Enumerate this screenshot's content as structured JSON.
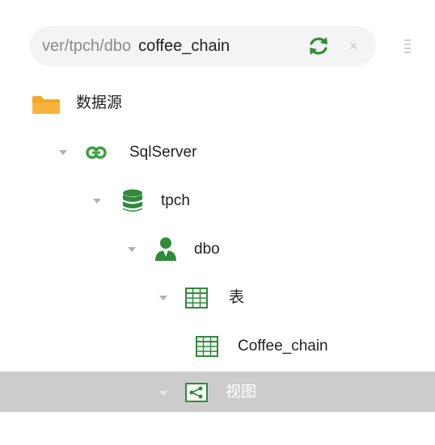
{
  "search": {
    "path_prefix": "ver/tpch/dbo",
    "current": "coffee_chain",
    "clear_glyph": "×",
    "refresh_icon": "refresh-icon",
    "menu_icon": "more-vertical-icon"
  },
  "colors": {
    "accent_green": "#2e8b3a",
    "folder_orange": "#f5a623",
    "selected_row": "#cccccc"
  },
  "tree": {
    "root": {
      "label": "数据源",
      "icon": "folder-icon"
    },
    "connection": {
      "label": "SqlServer",
      "icon": "link-icon"
    },
    "database": {
      "label": "tpch",
      "icon": "database-icon"
    },
    "schema": {
      "label": "dbo",
      "icon": "user-icon"
    },
    "tables_group": {
      "label": "表",
      "icon": "table-icon"
    },
    "table_item": {
      "label": "Coffee_chain",
      "icon": "table-icon"
    },
    "views_group": {
      "label": "视图",
      "icon": "view-icon",
      "selected": true
    }
  }
}
